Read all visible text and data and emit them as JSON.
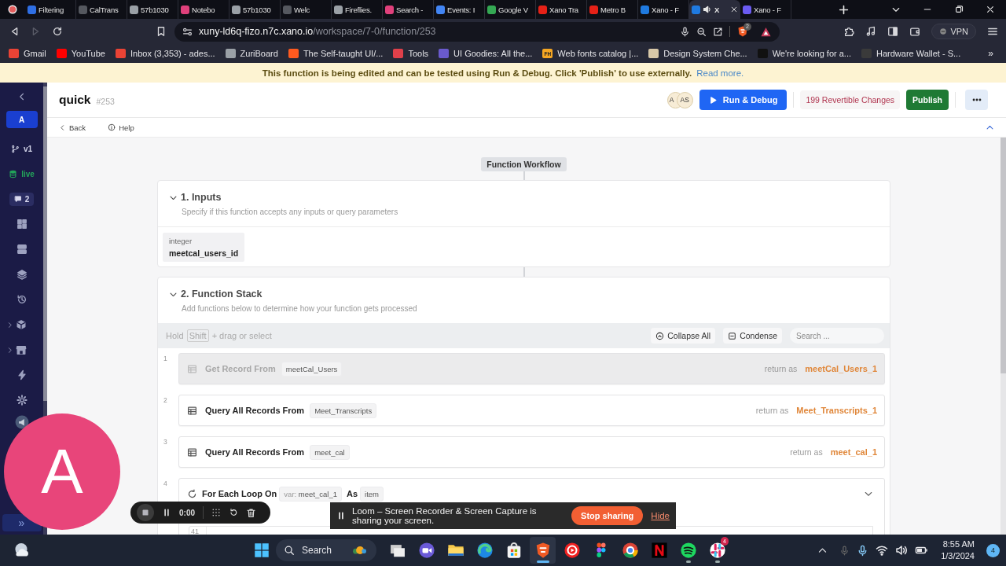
{
  "browser": {
    "tabs": [
      {
        "title": "Filtering",
        "color": "#2f6fe4",
        "selected": false,
        "audible": false
      },
      {
        "title": "CalTrans",
        "color": "#55585f",
        "selected": false,
        "audible": false
      },
      {
        "title": "57b1030",
        "color": "#9aa0a6",
        "selected": false,
        "audible": false
      },
      {
        "title": "Notebo",
        "color": "#e0407b",
        "selected": false,
        "audible": false
      },
      {
        "title": "57b1030",
        "color": "#9aa0a6",
        "selected": false,
        "audible": false
      },
      {
        "title": "Welc",
        "color": "#55585f",
        "selected": false,
        "audible": false
      },
      {
        "title": "Fireflies.",
        "color": "#9aa0a6",
        "selected": false,
        "audible": false
      },
      {
        "title": "Search -",
        "color": "#e0407b",
        "selected": false,
        "audible": false
      },
      {
        "title": "Events: I",
        "color": "#4285f4",
        "selected": false,
        "audible": false
      },
      {
        "title": "Google V",
        "color": "#34a853",
        "selected": false,
        "audible": false
      },
      {
        "title": "Xano Tra",
        "color": "#e62117",
        "selected": false,
        "audible": false
      },
      {
        "title": "Metro B",
        "color": "#e62117",
        "selected": false,
        "audible": false
      },
      {
        "title": "Xano - F",
        "color": "#1f7ae0",
        "selected": false,
        "audible": false
      },
      {
        "title": "X",
        "color": "#1f7ae0",
        "selected": true,
        "audible": true
      },
      {
        "title": "Xano - F",
        "color": "#6b5bf0",
        "selected": false,
        "audible": false
      }
    ],
    "url_host": "xuny-ld6q-fizo.n7c.xano.io",
    "url_path": "/workspace/7-0/function/253",
    "shield_count": "2",
    "vpn_label": "VPN",
    "bookmarks": [
      {
        "label": "Gmail",
        "color": "#ea4335"
      },
      {
        "label": "YouTube",
        "color": "#ff0000"
      },
      {
        "label": "Inbox (3,353) - ades...",
        "color": "#ea4335"
      },
      {
        "label": "ZuriBoard",
        "color": "#9aa0a6"
      },
      {
        "label": "The Self-taught UI/...",
        "color": "#ff5a1f"
      },
      {
        "label": "Tools",
        "color": "#e0404a"
      },
      {
        "label": "UI Goodies: All the...",
        "color": "#6a5acd"
      },
      {
        "label": "Web fonts catalog |...",
        "color": "#f5a623",
        "icon_text": "FH"
      },
      {
        "label": "Design System Che...",
        "color": "#d8c8a8"
      },
      {
        "label": "We're looking for a...",
        "color": "#111111"
      },
      {
        "label": "Hardware Wallet - S...",
        "color": "#3a3a3a"
      }
    ],
    "more_bookmarks": "»"
  },
  "banner": {
    "message": "This function is being edited and can be tested using Run & Debug. Click 'Publish' to use externally.",
    "link": "Read more."
  },
  "sidebar": {
    "workspace": "A",
    "branch": "v1",
    "status": "live",
    "comments": "2",
    "more": "»"
  },
  "header": {
    "title": "quick",
    "id": "#253",
    "avatars": [
      "A",
      "AS"
    ],
    "run_label": "Run & Debug",
    "changes": "199 Revertible Changes",
    "publish": "Publish",
    "back": "Back",
    "help": "Help"
  },
  "workflow": {
    "label": "Function Workflow",
    "inputs": {
      "title": "1. Inputs",
      "subtitle": "Specify if this function accepts any inputs or query parameters",
      "params": [
        {
          "type": "integer",
          "name": "meetcal_users_id"
        }
      ]
    },
    "stack": {
      "title": "2. Function Stack",
      "subtitle": "Add functions below to determine how your function gets processed",
      "hint_pre": "Hold",
      "hint_key": "Shift",
      "hint_post": "+ drag or select",
      "collapse": "Collapse All",
      "condense": "Condense",
      "search_placeholder": "Search ...",
      "steps": [
        {
          "kind": "query",
          "number": "1",
          "title": "Get Record From",
          "table": "meetCal_Users",
          "return_label": "return as",
          "return_var": "meetCal_Users_1",
          "disabled": true
        },
        {
          "kind": "query",
          "number": "2",
          "title": "Query All Records From",
          "table": "Meet_Transcripts",
          "return_label": "return as",
          "return_var": "Meet_Transcripts_1",
          "disabled": false
        },
        {
          "kind": "query",
          "number": "3",
          "title": "Query All Records From",
          "table": "meet_cal",
          "return_label": "return as",
          "return_var": "meet_cal_1",
          "disabled": false
        },
        {
          "kind": "loop",
          "number": "4",
          "title": "For Each Loop On",
          "var_prefix": "var:",
          "var": "meet_cal_1",
          "as_label": "As",
          "item": "item",
          "line_number": "41",
          "disabled": false
        }
      ]
    }
  },
  "loom": {
    "avatar": "A",
    "timer": "0:00",
    "message": "Loom – Screen Recorder & Screen Capture is sharing your screen.",
    "stop": "Stop sharing",
    "hide": "Hide"
  },
  "taskbar": {
    "search_label": "Search",
    "apps": [
      {
        "running": false,
        "selected": false
      },
      {
        "running": false,
        "selected": false
      },
      {
        "running": false,
        "selected": false
      },
      {
        "running": false,
        "selected": false
      },
      {
        "running": false,
        "selected": false
      },
      {
        "running": true,
        "selected": true
      },
      {
        "running": false,
        "selected": false
      },
      {
        "running": false,
        "selected": false
      },
      {
        "running": false,
        "selected": false
      },
      {
        "running": false,
        "selected": false
      },
      {
        "running": true,
        "selected": false
      },
      {
        "running": true,
        "selected": false,
        "badge": "4"
      }
    ],
    "time": "8:55 AM",
    "date": "1/3/2024",
    "notifications": "4"
  }
}
